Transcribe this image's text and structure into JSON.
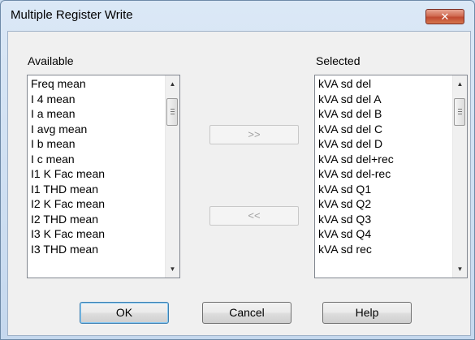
{
  "window": {
    "title": "Multiple Register Write",
    "close_label": "✕"
  },
  "available": {
    "label": "Available",
    "items": [
      "Freq mean",
      "I 4 mean",
      "I a mean",
      "I avg mean",
      "I b mean",
      "I c mean",
      "I1 K Fac mean",
      "I1 THD mean",
      "I2 K Fac mean",
      "I2 THD mean",
      "I3 K Fac mean",
      "I3 THD mean"
    ]
  },
  "selected": {
    "label": "Selected",
    "items": [
      "kVA sd del",
      "kVA sd del A",
      "kVA sd del B",
      "kVA sd del C",
      "kVA sd del D",
      "kVA sd del+rec",
      "kVA sd del-rec",
      "kVA sd Q1",
      "kVA sd Q2",
      "kVA sd Q3",
      "kVA sd Q4",
      "kVA sd rec"
    ]
  },
  "transfer": {
    "add_label": ">>",
    "remove_label": "<<"
  },
  "buttons": {
    "ok": "OK",
    "cancel": "Cancel",
    "help": "Help"
  },
  "icons": {
    "scroll_up": "up-arrow-icon",
    "scroll_down": "down-arrow-icon",
    "close": "close-icon"
  }
}
